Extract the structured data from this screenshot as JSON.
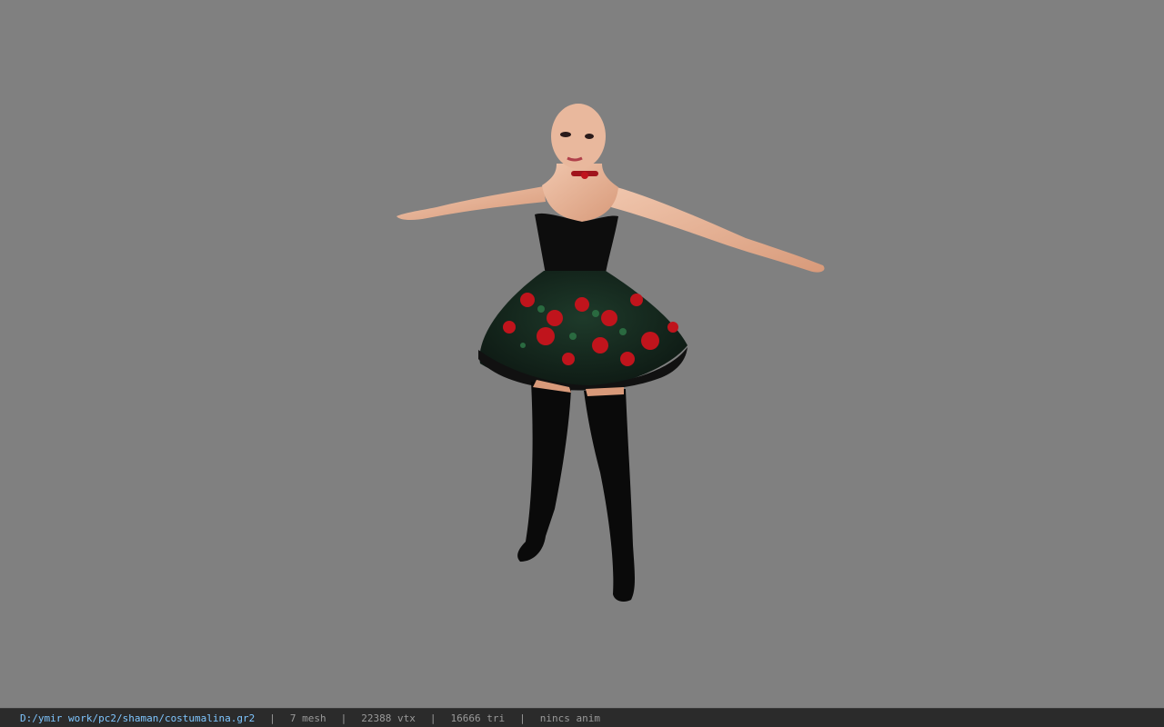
{
  "status_bar": {
    "file_path": "D:/ymir work/pc2/shaman/costumalina.gr2",
    "separator": "|",
    "mesh_count": "7 mesh",
    "vertex_count": "22388 vtx",
    "triangle_count": "16666 tri",
    "animation": "nincs anim"
  },
  "colors": {
    "background": "#808080",
    "status_bar_bg": "#2b2b2b",
    "path_text": "#7fc6ff",
    "stat_text": "#9a9a9a",
    "skin": "#e8b498",
    "dress": "#0d0d0d",
    "rose": "#c0141c",
    "leaf": "#1f4a30"
  }
}
